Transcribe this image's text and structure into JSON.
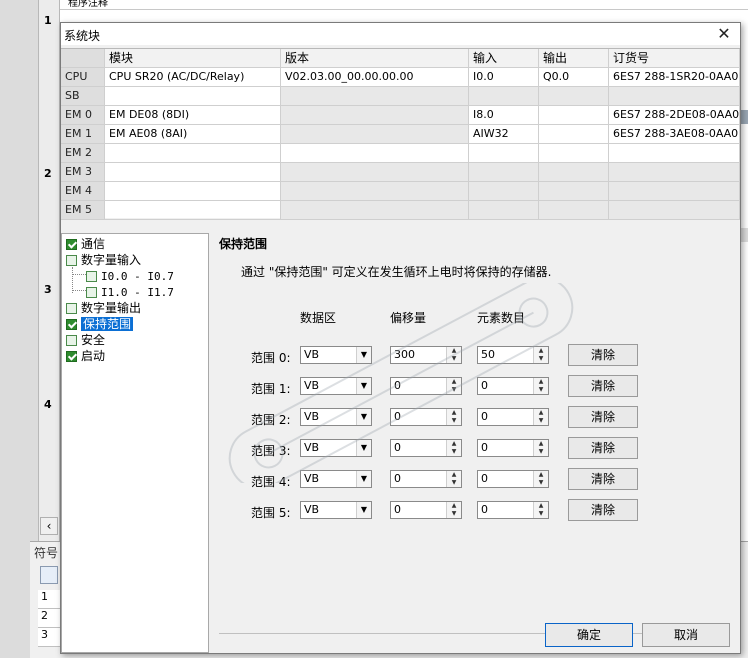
{
  "background": {
    "top_comment": "程序注释",
    "row_numbers": [
      "1",
      "2",
      "3",
      "4"
    ],
    "bottom_tab_label": "符号",
    "bottom_rows": [
      "1",
      "2",
      "3"
    ]
  },
  "dialog": {
    "title": "系统块",
    "close_glyph": "✕"
  },
  "module_table": {
    "headers": [
      "模块",
      "版本",
      "输入",
      "输出",
      "订货号"
    ],
    "rows": [
      {
        "slot": "CPU",
        "module": "CPU SR20 (AC/DC/Relay)",
        "version": "V02.03.00_00.00.00.00",
        "input": "I0.0",
        "output": "Q0.0",
        "order": "6ES7 288-1SR20-0AA0"
      },
      {
        "slot": "SB",
        "module": "",
        "version": "",
        "input": "",
        "output": "",
        "order": ""
      },
      {
        "slot": "EM 0",
        "module": "EM DE08 (8DI)",
        "version": "",
        "input": "I8.0",
        "output": "",
        "order": "6ES7 288-2DE08-0AA0"
      },
      {
        "slot": "EM 1",
        "module": "EM AE08 (8AI)",
        "version": "",
        "input": "AIW32",
        "output": "",
        "order": "6ES7 288-3AE08-0AA0"
      },
      {
        "slot": "EM 2",
        "module": "",
        "version": "",
        "input": "",
        "output": "",
        "order": ""
      },
      {
        "slot": "EM 3",
        "module": "",
        "version": "",
        "input": "",
        "output": "",
        "order": ""
      },
      {
        "slot": "EM 4",
        "module": "",
        "version": "",
        "input": "",
        "output": "",
        "order": ""
      },
      {
        "slot": "EM 5",
        "module": "",
        "version": "",
        "input": "",
        "output": "",
        "order": ""
      }
    ]
  },
  "tree": {
    "items": [
      {
        "label": "通信",
        "checked": true
      },
      {
        "label": "数字量输入",
        "checked": false
      },
      {
        "label": "I0.0 - I0.7",
        "checked": false
      },
      {
        "label": "I1.0 - I1.7",
        "checked": false
      },
      {
        "label": "数字量输出",
        "checked": false
      },
      {
        "label": "保持范围",
        "checked": true,
        "selected": true
      },
      {
        "label": "安全",
        "checked": false
      },
      {
        "label": "启动",
        "checked": true
      }
    ]
  },
  "retain": {
    "title": "保持范围",
    "description": "通过 \"保持范围\" 可定义在发生循环上电时将保持的存储器.",
    "col_area": "数据区",
    "col_offset": "偏移量",
    "col_count": "元素数目",
    "clear_label": "清除",
    "ranges": [
      {
        "label": "范围 0:",
        "area": "VB",
        "offset": "300",
        "count": "50"
      },
      {
        "label": "范围 1:",
        "area": "VB",
        "offset": "0",
        "count": "0"
      },
      {
        "label": "范围 2:",
        "area": "VB",
        "offset": "0",
        "count": "0"
      },
      {
        "label": "范围 3:",
        "area": "VB",
        "offset": "0",
        "count": "0"
      },
      {
        "label": "范围 4:",
        "area": "VB",
        "offset": "0",
        "count": "0"
      },
      {
        "label": "范围 5:",
        "area": "VB",
        "offset": "0",
        "count": "0"
      }
    ]
  },
  "footer": {
    "ok_label": "确定",
    "cancel_label": "取消"
  },
  "colors": {
    "selection": "#0b6fd4",
    "check_green": "#2e8b2e"
  }
}
